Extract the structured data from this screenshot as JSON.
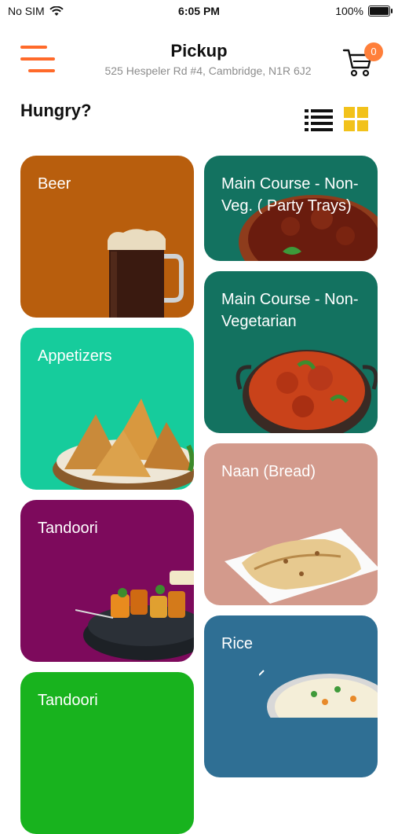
{
  "status_bar": {
    "carrier": "No SIM",
    "time": "6:05 PM",
    "battery": "100%"
  },
  "header": {
    "title": "Pickup",
    "address": "525 Hespeler Rd #4, Cambridge, N1R 6J2",
    "cart_count": "0"
  },
  "section": {
    "heading": "Hungry?"
  },
  "categories": [
    {
      "label": "Beer",
      "color": "#b85e0d"
    },
    {
      "label": "Main Course - Non-Veg. ( Party Trays)",
      "color": "#137260"
    },
    {
      "label": "Main Course - Non-Vegetarian",
      "color": "#137260"
    },
    {
      "label": "Appetizers",
      "color": "#16cc9c"
    },
    {
      "label": "Naan (Bread)",
      "color": "#d39a8c"
    },
    {
      "label": "Tandoori",
      "color": "#7d0a5c"
    },
    {
      "label": "Rice",
      "color": "#2f6f94"
    },
    {
      "label": "Tandoori",
      "color": "#18b31e"
    }
  ],
  "colors": {
    "accent": "#ff6a2a",
    "grid_active": "#f2c21b"
  }
}
